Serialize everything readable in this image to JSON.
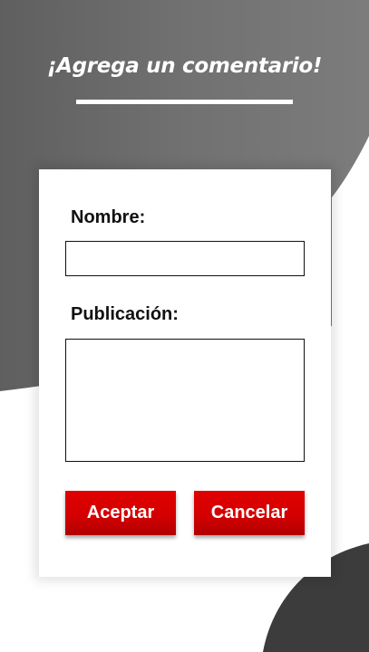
{
  "header": {
    "title": "¡Agrega un comentario!"
  },
  "form": {
    "name_label": "Nombre:",
    "name_value": "",
    "post_label": "Publicación:",
    "post_value": ""
  },
  "buttons": {
    "accept_label": "Aceptar",
    "cancel_label": "Cancelar"
  },
  "colors": {
    "background_gray": "#6e6e6e",
    "dark_blob": "#3f3f3f",
    "button_red": "#d40000",
    "card_white": "#ffffff"
  }
}
